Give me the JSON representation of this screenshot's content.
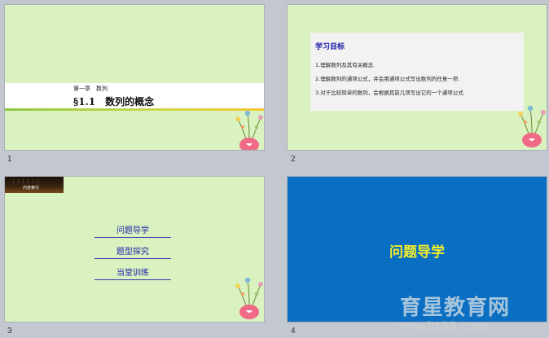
{
  "slides": [
    {
      "number": "1",
      "chapter": "第一章　数列",
      "section": "§1.1　数列的概念"
    },
    {
      "number": "2",
      "goal_title": "学习目标",
      "goals": [
        "1.理解数列及其有关概念.",
        "2.理解数列的通项公式，并会用通项公式写出数列的任意一项.",
        "3.对于比较简单的数列，会根据其前几项写出它的一个通项公式."
      ]
    },
    {
      "number": "3",
      "thumb_label": "内容索引",
      "links": [
        "问题导学",
        "题型探究",
        "当堂训练"
      ]
    },
    {
      "number": "4",
      "title": "问题导学"
    }
  ],
  "watermark": {
    "name": "育星教育网",
    "url": "www.ht88.com"
  },
  "colors": {
    "slide_green": "#d9f2c0",
    "slide_blue": "#0a6fc2",
    "title_yellow": "#f3ee2a",
    "link_blue": "#2222aa"
  }
}
